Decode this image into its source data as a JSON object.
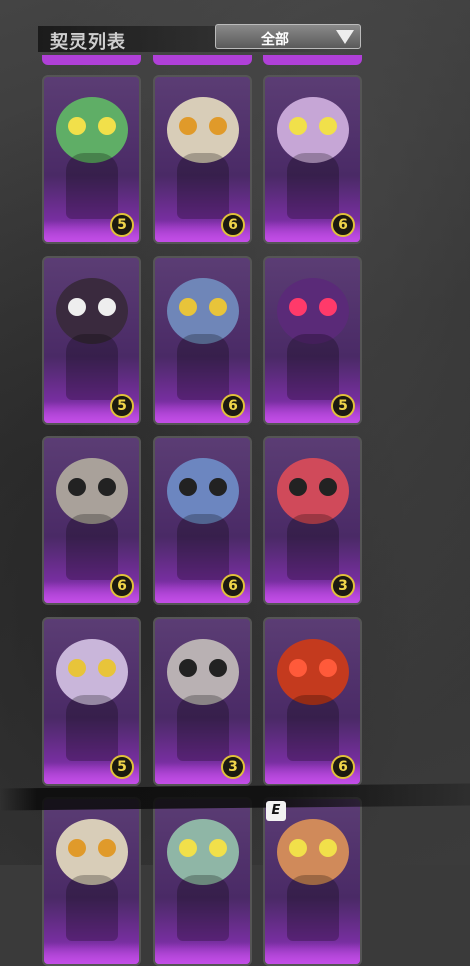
{
  "header": {
    "title": "契灵列表",
    "filter_value": "全部"
  },
  "hotkey": "E",
  "colors": {
    "card_purple": "#4a2a66",
    "card_glow": "#c24ee6",
    "badge_ring": "#e0c23a",
    "badge_text": "#f0d54a"
  },
  "cards": [
    {
      "row": 0,
      "col": 0,
      "creature": "green-frog-creature",
      "level": "5"
    },
    {
      "row": 0,
      "col": 1,
      "creature": "bandaged-mummy-creature",
      "level": "6"
    },
    {
      "row": 0,
      "col": 2,
      "creature": "lilac-frog-creature",
      "level": "6"
    },
    {
      "row": 1,
      "col": 0,
      "creature": "dark-shadow-creature",
      "level": "5"
    },
    {
      "row": 1,
      "col": 1,
      "creature": "blue-furry-creature",
      "level": "6"
    },
    {
      "row": 1,
      "col": 2,
      "creature": "purple-hooded-creature",
      "level": "5"
    },
    {
      "row": 2,
      "col": 0,
      "creature": "grey-masked-creature",
      "level": "6"
    },
    {
      "row": 2,
      "col": 1,
      "creature": "blue-masked-creature",
      "level": "6"
    },
    {
      "row": 2,
      "col": 2,
      "creature": "red-masked-creature",
      "level": "3"
    },
    {
      "row": 3,
      "col": 0,
      "creature": "lavender-furry-creature",
      "level": "5"
    },
    {
      "row": 3,
      "col": 1,
      "creature": "grey-white-masked-creature",
      "level": "3"
    },
    {
      "row": 3,
      "col": 2,
      "creature": "red-hooded-creature",
      "level": "6"
    },
    {
      "row": 4,
      "col": 0,
      "creature": "bandaged-mummy-creature",
      "level": ""
    },
    {
      "row": 4,
      "col": 1,
      "creature": "teal-frog-creature",
      "level": ""
    },
    {
      "row": 4,
      "col": 2,
      "creature": "orange-frog-creature",
      "level": ""
    }
  ]
}
